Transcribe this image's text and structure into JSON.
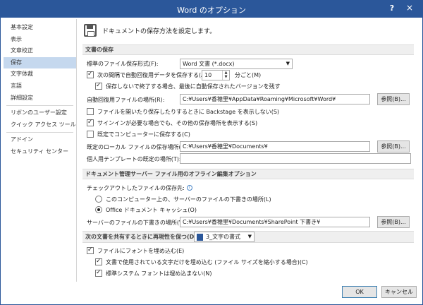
{
  "window": {
    "title": "Word のオプション",
    "help": "?",
    "close": "×"
  },
  "sidebar": {
    "items": [
      {
        "label": "基本設定",
        "selected": false
      },
      {
        "label": "表示",
        "selected": false
      },
      {
        "label": "文章校正",
        "selected": false
      },
      {
        "label": "保存",
        "selected": true
      },
      {
        "label": "文字体裁",
        "selected": false
      },
      {
        "label": "言語",
        "selected": false
      },
      {
        "label": "詳細設定",
        "selected": false
      },
      {
        "label": "リボンのユーザー設定",
        "selected": false
      },
      {
        "label": "クイック アクセス ツール バー",
        "selected": false
      },
      {
        "label": "アドイン",
        "selected": false
      },
      {
        "label": "セキュリティ センター",
        "selected": false
      }
    ]
  },
  "header": {
    "text": "ドキュメントの保存方法を設定します。"
  },
  "save_docs": {
    "section_title": "文書の保存",
    "format_label": "標準のファイル保存形式(F):",
    "format_value": "Word 文書 (*.docx)",
    "autorecover_label": "次の間隔で自動回復用データを保存する(A):",
    "autorecover_checked": true,
    "autorecover_minutes": "10",
    "minutes_suffix": "分ごと(M)",
    "keep_last_label": "保存しないで終了する場合、最後に自動保存されたバージョンを残す",
    "keep_last_checked": true,
    "autorecover_location_label": "自動回復用ファイルの場所(R):",
    "autorecover_location_value": "C:¥Users¥香穂里¥AppData¥Roaming¥Microsoft¥Word¥",
    "browse1": "参照(B)...",
    "backstage_label": "ファイルを開いたり保存したりするときに Backstage を表示しない(S)",
    "backstage_checked": false,
    "signin_label": "サインインが必要な場合でも、その他の保存場所を表示する(S)",
    "signin_checked": true,
    "default_computer_label": "既定でコンピューターに保存する(C)",
    "default_computer_checked": false,
    "local_location_label": "既定のローカル ファイルの保存場所(I):",
    "local_location_value": "C:¥Users¥香穂里¥Documents¥",
    "browse2": "参照(B)...",
    "template_location_label": "個人用テンプレートの既定の場所(T):",
    "template_location_value": ""
  },
  "offline": {
    "section_title": "ドキュメント管理サーバー ファイル用のオフライン編集オプション",
    "checkout_label": "チェックアウトしたファイルの保存先:",
    "radio1_label": "このコンピューター上の、サーバーのファイルの下書きの場所(L)",
    "radio1_checked": false,
    "radio2_label": "Office ドキュメント キャッシュ(O)",
    "radio2_checked": true,
    "drafts_label": "サーバーのファイルの下書きの場所(V):",
    "drafts_value": "C:¥Users¥香穂里¥Documents¥SharePoint 下書き¥",
    "browse3": "参照(B)..."
  },
  "fidelity": {
    "section_title": "次の文書を共有するときに再現性を保つ(D):",
    "doc_value": "3_文字の書式",
    "embed_fonts_label": "ファイルにフォントを埋め込む(E)",
    "embed_fonts_checked": true,
    "embed_used_label": "文書で使用されている文字だけを埋め込む (ファイル サイズを縮小する場合)(C)",
    "embed_used_checked": true,
    "no_system_label": "標準システム フォントは埋め込まない(N)",
    "no_system_checked": true
  },
  "footer": {
    "ok": "OK",
    "cancel": "キャンセル"
  }
}
